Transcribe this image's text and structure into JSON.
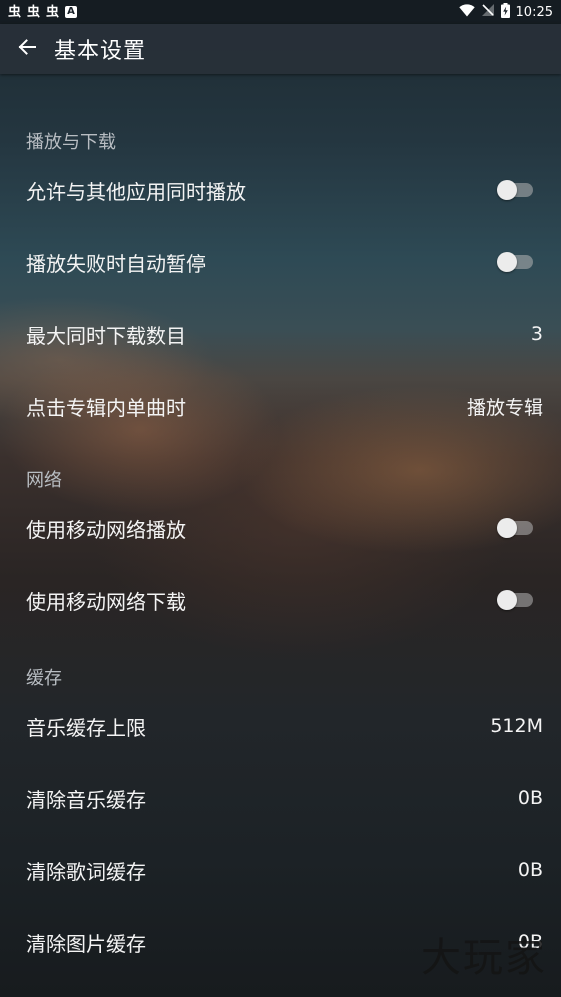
{
  "status_bar": {
    "notifications": [
      "虫",
      "虫",
      "虫"
    ],
    "notif_a": "A",
    "time": "10:25",
    "icons": [
      "wifi-icon",
      "no-signal-icon",
      "battery-charging-icon"
    ]
  },
  "app_bar": {
    "back_icon": "arrow-left-icon",
    "title": "基本设置"
  },
  "sections": {
    "playback": {
      "header": "播放与下载",
      "allow_concurrent": {
        "label": "允许与其他应用同时播放",
        "enabled": false
      },
      "auto_pause": {
        "label": "播放失败时自动暂停",
        "enabled": false
      },
      "max_downloads": {
        "label": "最大同时下载数目",
        "value": "3"
      },
      "album_click": {
        "label": "点击专辑内单曲时",
        "value": "播放专辑"
      }
    },
    "network": {
      "header": "网络",
      "mobile_play": {
        "label": "使用移动网络播放",
        "enabled": false
      },
      "mobile_download": {
        "label": "使用移动网络下载",
        "enabled": false
      }
    },
    "cache": {
      "header": "缓存",
      "music_limit": {
        "label": "音乐缓存上限",
        "value": "512M"
      },
      "clear_music": {
        "label": "清除音乐缓存",
        "value": "0B"
      },
      "clear_lyrics": {
        "label": "清除歌词缓存",
        "value": "0B"
      },
      "clear_images": {
        "label": "清除图片缓存",
        "value": "0B"
      }
    }
  },
  "watermark": "大玩家",
  "colors": {
    "appbar": "#283038",
    "text": "#f4f4f4",
    "section_header": "#b8bdc2",
    "switch_off_track": "#b4b4b4",
    "switch_off_thumb": "#ececec"
  }
}
